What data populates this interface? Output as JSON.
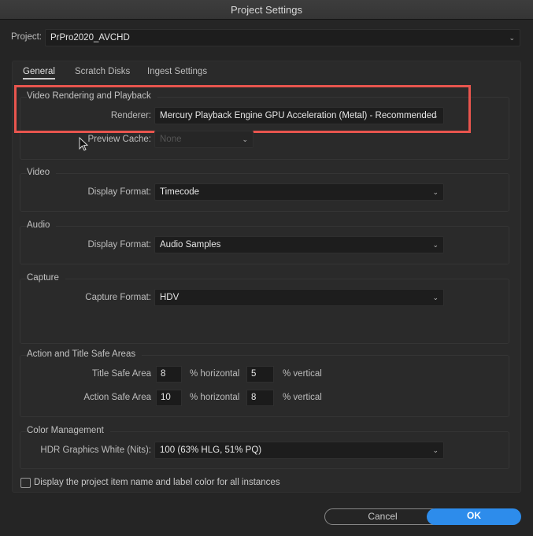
{
  "title": "Project Settings",
  "project": {
    "label": "Project:",
    "value": "PrPro2020_AVCHD"
  },
  "tabs": [
    {
      "label": "General",
      "active": true
    },
    {
      "label": "Scratch Disks"
    },
    {
      "label": "Ingest Settings"
    }
  ],
  "video_rendering": {
    "title": "Video Rendering and Playback",
    "renderer_label": "Renderer:",
    "renderer_value": "Mercury Playback Engine GPU Acceleration (Metal) - Recommended",
    "preview_cache_label": "Preview Cache:",
    "preview_cache_value": "None"
  },
  "video": {
    "title": "Video",
    "display_format_label": "Display Format:",
    "display_format_value": "Timecode"
  },
  "audio": {
    "title": "Audio",
    "display_format_label": "Display Format:",
    "display_format_value": "Audio Samples"
  },
  "capture": {
    "title": "Capture",
    "capture_format_label": "Capture Format:",
    "capture_format_value": "HDV"
  },
  "safe_areas": {
    "title": "Action and Title Safe Areas",
    "title_safe": {
      "label": "Title Safe Area",
      "horizontal": "8",
      "vertical": "5"
    },
    "action_safe": {
      "label": "Action Safe Area",
      "horizontal": "10",
      "vertical": "8"
    },
    "horizontal_unit": "% horizontal",
    "vertical_unit": "% vertical"
  },
  "color_management": {
    "title": "Color Management",
    "hdr_label": "HDR Graphics White (Nits):",
    "hdr_value": "100 (63% HLG, 51% PQ)"
  },
  "display_label_checkbox": {
    "label": "Display the project item name and label color for all instances",
    "checked": false
  },
  "buttons": {
    "cancel": "Cancel",
    "ok": "OK"
  },
  "colors": {
    "highlight": "#e8554e",
    "ok": "#2d8ceb"
  }
}
